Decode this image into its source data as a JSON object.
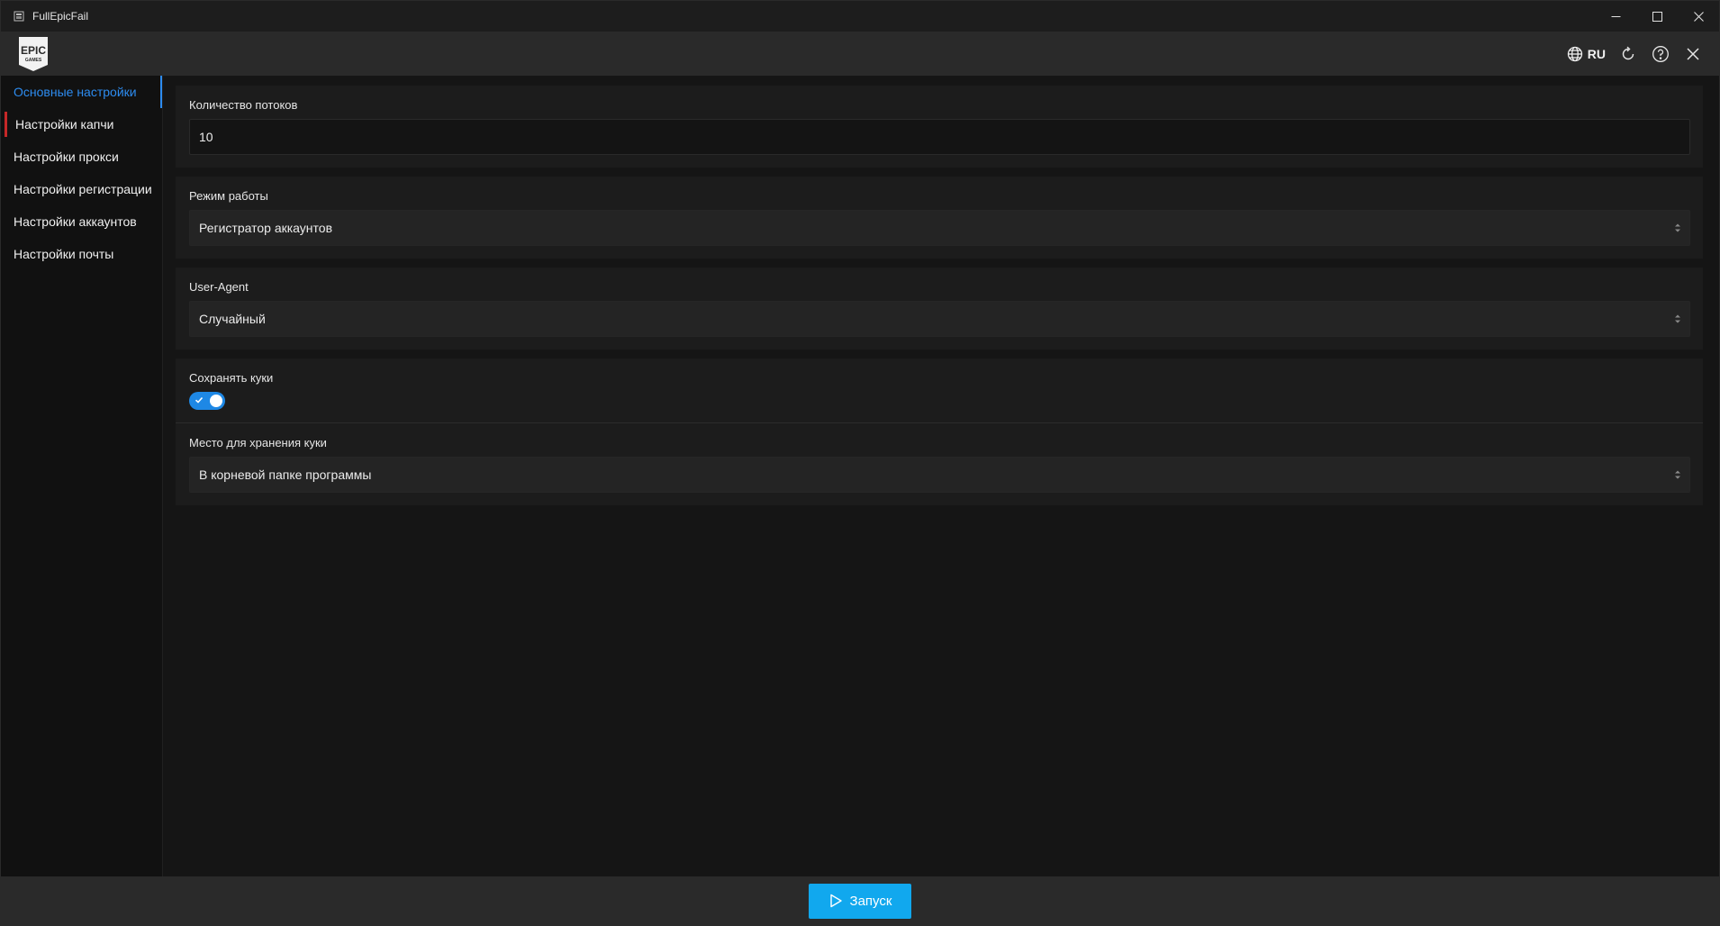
{
  "window": {
    "title": "FullEpicFail",
    "controls": {
      "minimize": "minimize-icon",
      "maximize": "maximize-icon",
      "close": "close-icon"
    }
  },
  "header": {
    "logo": {
      "line1": "EPIC",
      "line2": "GAMES"
    },
    "language": "RU",
    "icons": [
      "globe-icon",
      "refresh-icon",
      "help-icon",
      "close-icon"
    ]
  },
  "sidebar": {
    "items": [
      {
        "label": "Основные настройки",
        "active": true
      },
      {
        "label": "Настройки капчи"
      },
      {
        "label": "Настройки прокси"
      },
      {
        "label": "Настройки регистрации"
      },
      {
        "label": "Настройки аккаунтов"
      },
      {
        "label": "Настройки почты"
      }
    ]
  },
  "settings": {
    "threads": {
      "label": "Количество потоков",
      "value": "10"
    },
    "mode": {
      "label": "Режим работы",
      "value": "Регистратор аккаунтов"
    },
    "user_agent": {
      "label": "User-Agent",
      "value": "Случайный"
    },
    "save_cookies": {
      "label": "Сохранять куки",
      "enabled": true
    },
    "cookie_storage": {
      "label": "Место для хранения куки",
      "value": "В корневой папке программы"
    }
  },
  "footer": {
    "run_label": "Запуск"
  },
  "colors": {
    "accent": "#2d8cf0",
    "run_button": "#11a8ee",
    "toggle_on": "#1e88e5",
    "marker_red": "#c62828"
  }
}
